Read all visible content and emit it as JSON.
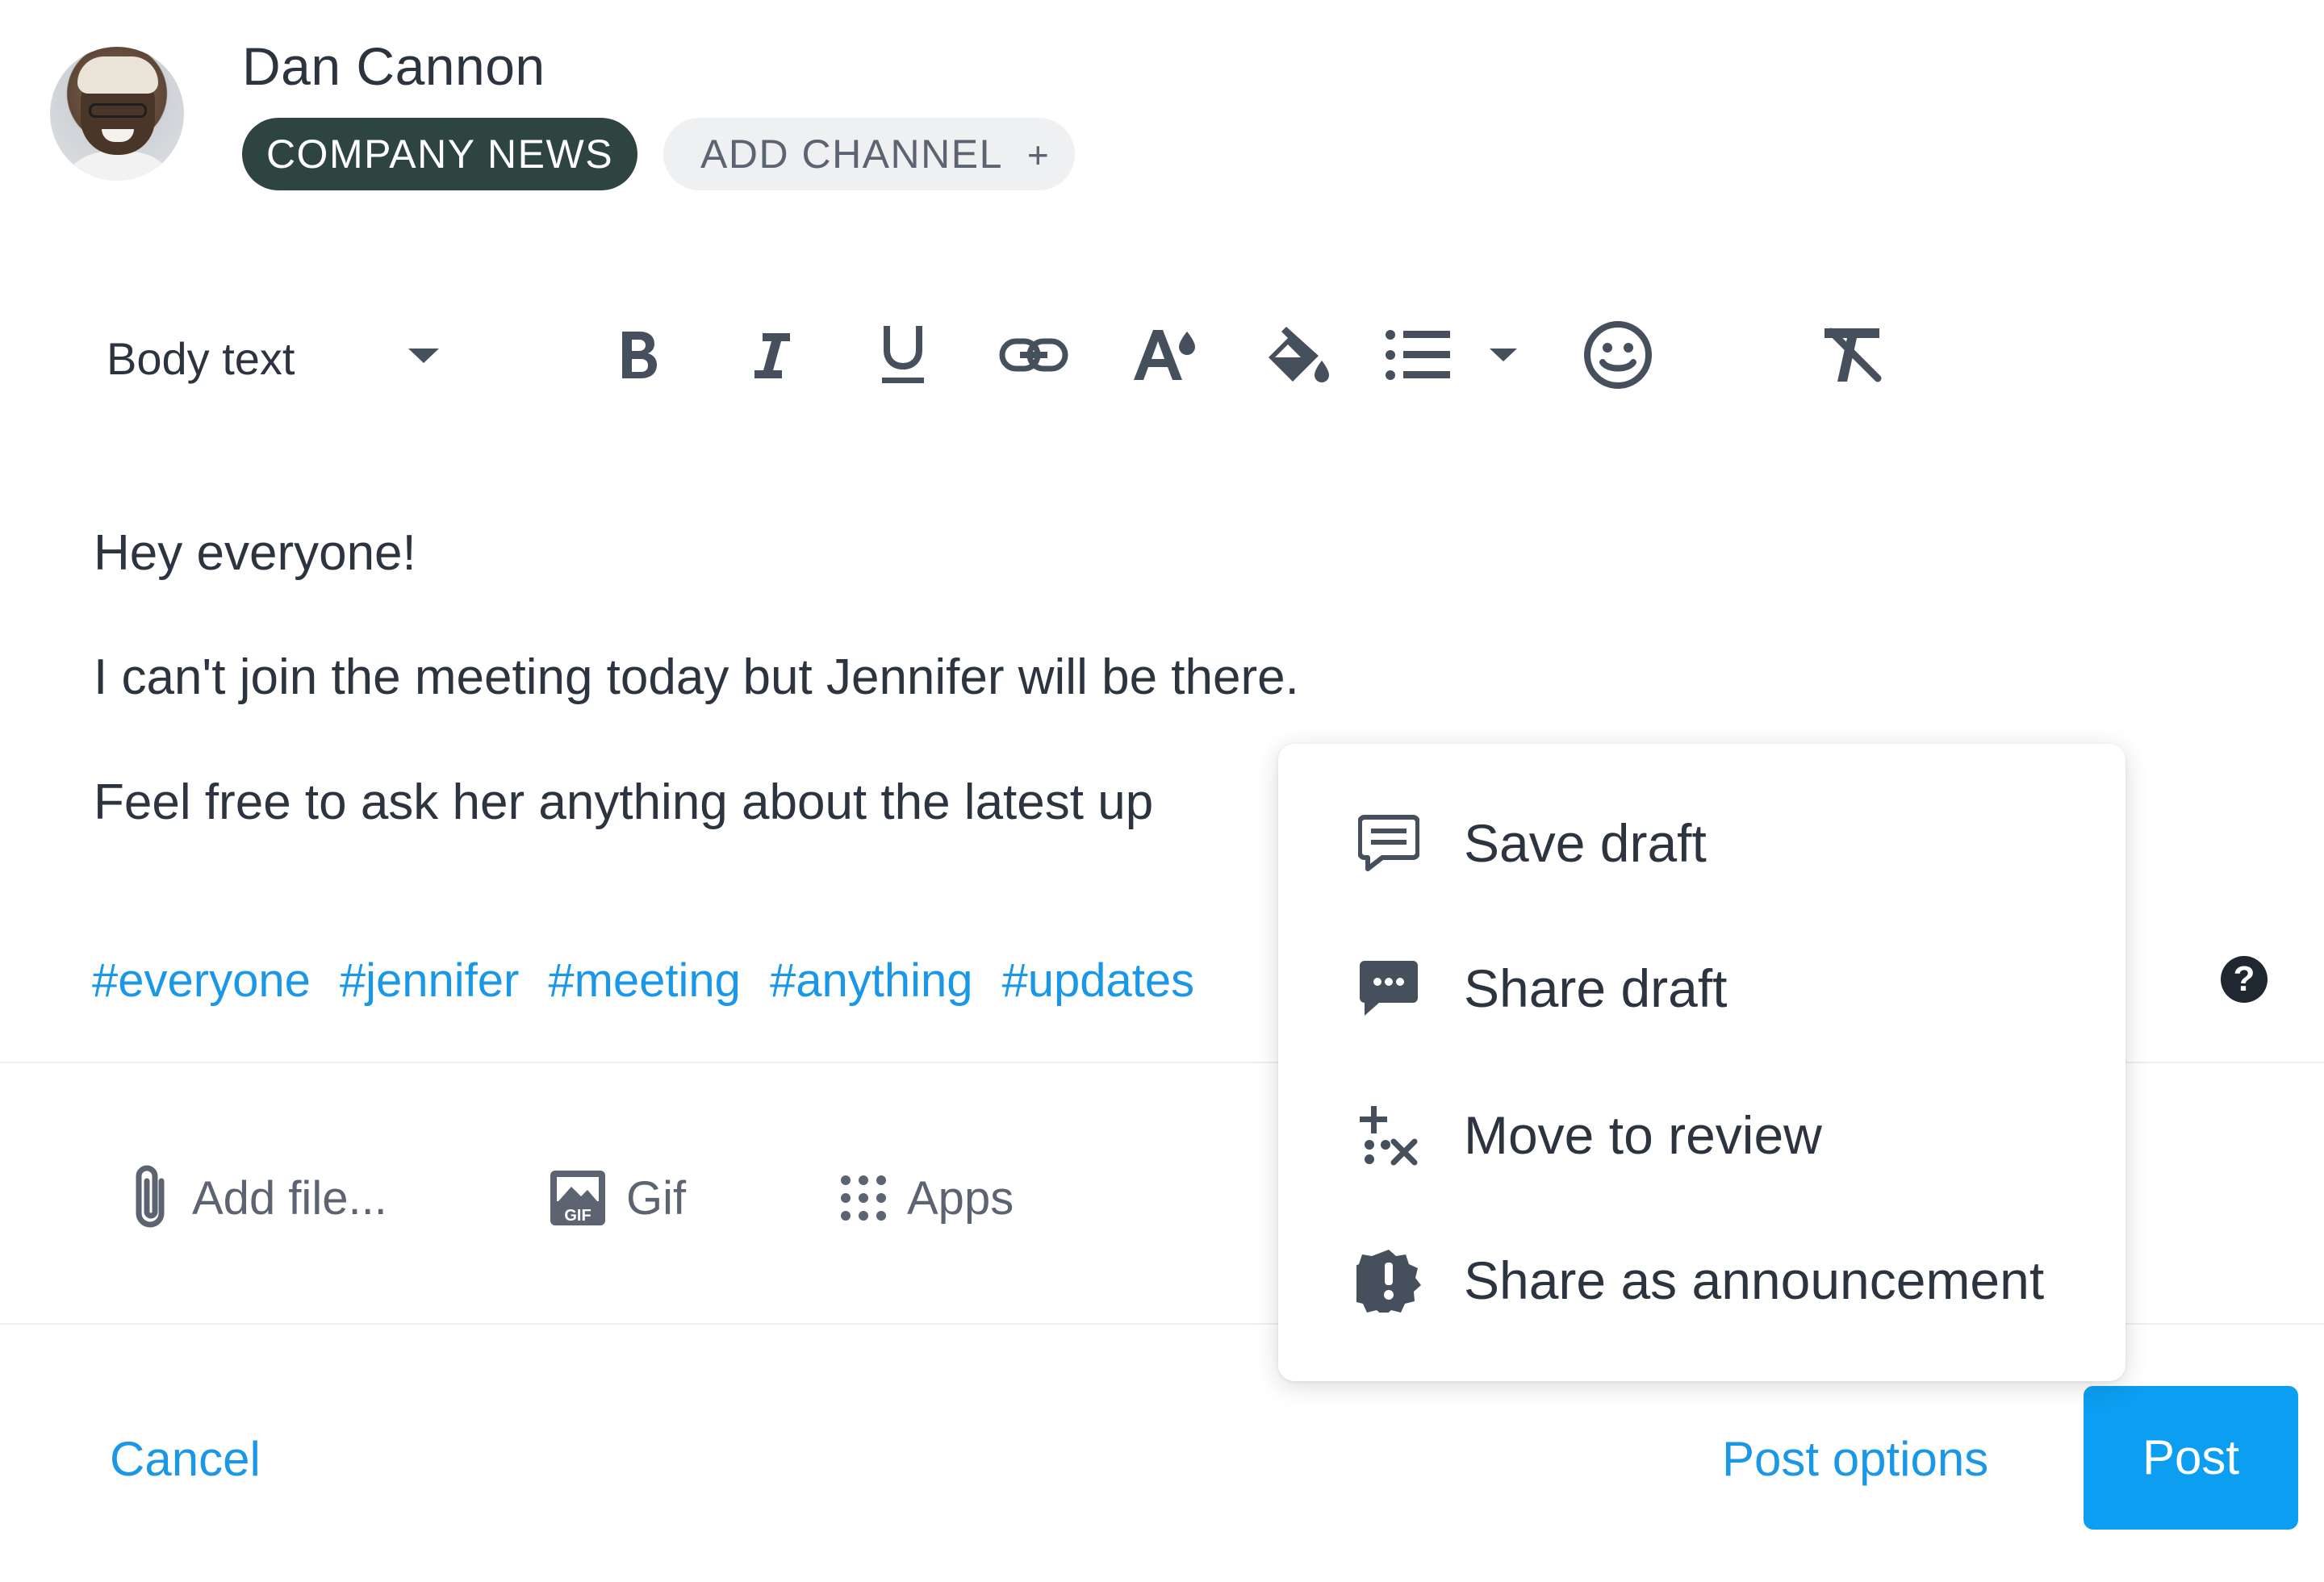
{
  "header": {
    "user_name": "Dan Cannon",
    "channel_chip": "COMPANY NEWS",
    "add_channel_label": "ADD CHANNEL",
    "add_channel_icon": "+"
  },
  "toolbar": {
    "text_style": "Body text",
    "tools": [
      "bold-icon",
      "italic-icon",
      "underline-icon",
      "link-icon",
      "font-color-icon",
      "fill-color-icon",
      "bullet-list-icon",
      "emoji-icon",
      "clear-format-icon"
    ]
  },
  "editor": {
    "paragraphs": [
      "Hey everyone!",
      "I can't join the meeting today but Jennifer will be there.",
      "Feel free to ask her anything about the latest up"
    ],
    "tags": [
      "#everyone",
      "#jennifer",
      "#meeting",
      "#anything",
      "#updates"
    ],
    "help_icon": "?"
  },
  "attachments": {
    "add_file": "Add file...",
    "gif": "Gif",
    "apps": "Apps"
  },
  "footer": {
    "cancel": "Cancel",
    "post_options": "Post options",
    "post": "Post"
  },
  "menu": {
    "items": [
      {
        "label": "Save draft",
        "icon": "comment-lines-icon"
      },
      {
        "label": "Share draft",
        "icon": "comment-dots-icon"
      },
      {
        "label": "Move to review",
        "icon": "review-icon"
      },
      {
        "label": "Share as announcement",
        "icon": "announcement-badge-icon"
      }
    ]
  },
  "colors": {
    "accent_blue": "#0c9ef1",
    "link_blue": "#1a97e6",
    "chip_dark": "#2e4440",
    "text": "#2c3440"
  }
}
